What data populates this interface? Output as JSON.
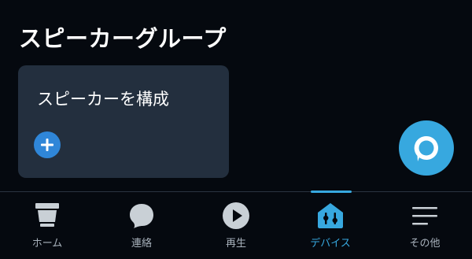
{
  "header": {
    "title": "スピーカーグループ"
  },
  "card": {
    "label": "スピーカーを構成",
    "add_icon": "plus-icon"
  },
  "alexa": {
    "icon": "alexa-icon"
  },
  "nav": {
    "items": [
      {
        "label": "ホーム",
        "icon": "home-icon"
      },
      {
        "label": "連絡",
        "icon": "chat-bubble-icon"
      },
      {
        "label": "再生",
        "icon": "play-icon"
      },
      {
        "label": "デバイス",
        "icon": "devices-icon"
      },
      {
        "label": "その他",
        "icon": "menu-icon"
      }
    ],
    "active_index": 3
  },
  "colors": {
    "background": "#05090f",
    "card": "#232f3e",
    "accent": "#37a8df",
    "add_button": "#2f86d8",
    "nav_label": "#a8b2bc"
  }
}
